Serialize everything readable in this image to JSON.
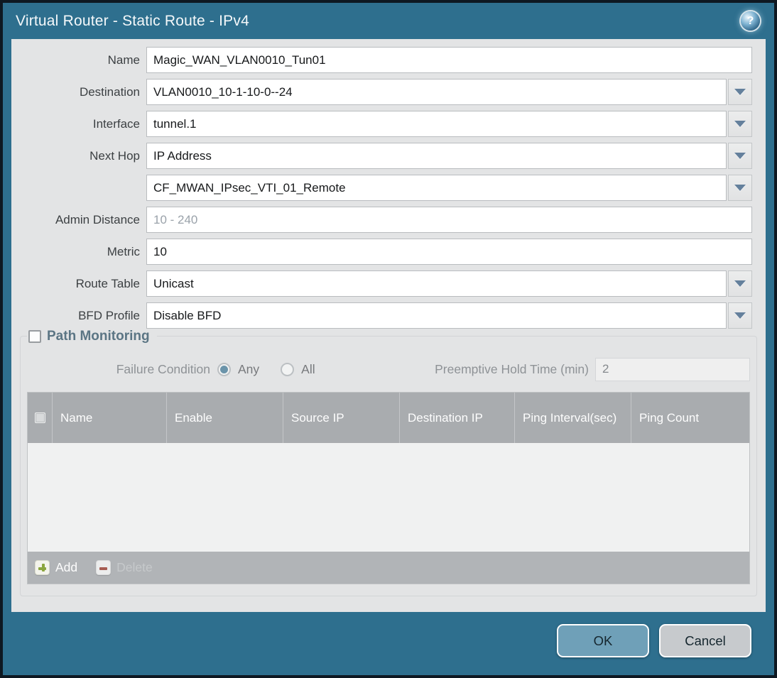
{
  "window": {
    "title": "Virtual Router - Static Route - IPv4",
    "help_glyph": "?"
  },
  "colors": {
    "frame_teal": "#2e6f8e",
    "outer_border": "#0e1821",
    "body_bg": "#e3e4e5",
    "table_header_bg": "#a9acaf",
    "ok_button_bg": "#6fa0b8",
    "cancel_button_bg": "#c7cacd",
    "radio_selected": "#6b94aa",
    "add_plus_green": "#8ba63e",
    "delete_minus_red": "#a65c52"
  },
  "form": {
    "fields": [
      {
        "label": "Name",
        "value": "Magic_WAN_VLAN0010_Tun01",
        "type": "text"
      },
      {
        "label": "Destination",
        "value": "VLAN0010_10-1-10-0--24",
        "type": "dropdown"
      },
      {
        "label": "Interface",
        "value": "tunnel.1",
        "type": "dropdown"
      },
      {
        "label": "Next Hop",
        "value": "IP Address",
        "type": "dropdown"
      },
      {
        "label": "",
        "value": "CF_MWAN_IPsec_VTI_01_Remote",
        "type": "dropdown"
      },
      {
        "label": "Admin Distance",
        "value": "",
        "placeholder": "10 - 240",
        "type": "text"
      },
      {
        "label": "Metric",
        "value": "10",
        "type": "text"
      },
      {
        "label": "Route Table",
        "value": "Unicast",
        "type": "dropdown"
      },
      {
        "label": "BFD Profile",
        "value": "Disable BFD",
        "type": "dropdown"
      }
    ]
  },
  "path_monitoring": {
    "section_title": "Path Monitoring",
    "checkbox_checked": false,
    "failure_condition_label": "Failure Condition",
    "options": [
      {
        "label": "Any",
        "selected": true
      },
      {
        "label": "All",
        "selected": false
      }
    ],
    "hold_time_label": "Preemptive Hold Time (min)",
    "hold_time_value": "2",
    "table": {
      "columns": [
        "Name",
        "Enable",
        "Source IP",
        "Destination IP",
        "Ping Interval(sec)",
        "Ping Count"
      ],
      "rows": []
    },
    "toolbar": {
      "add_label": "Add",
      "delete_label": "Delete"
    }
  },
  "footer": {
    "ok_label": "OK",
    "cancel_label": "Cancel"
  }
}
